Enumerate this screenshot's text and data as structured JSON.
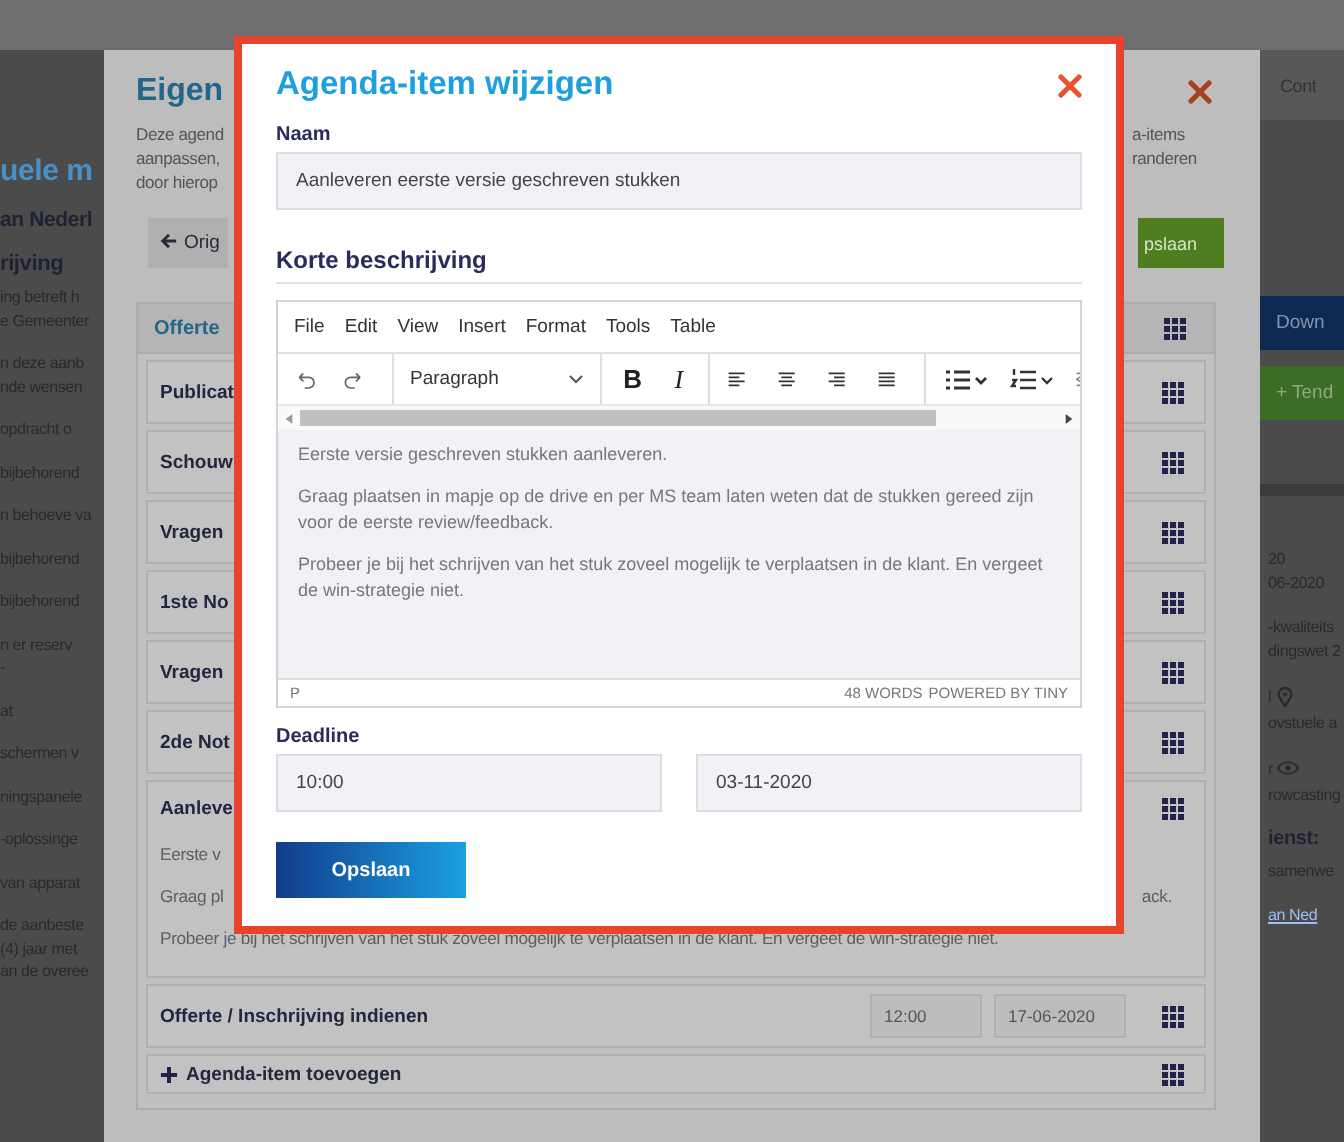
{
  "background_page": {
    "header_tab": "Cont",
    "left_blocks": [
      {
        "kind": "title",
        "lines": [
          "uele m"
        ]
      },
      {
        "kind": "subtitle",
        "lines": [
          "an Nederl"
        ]
      },
      {
        "kind": "heading",
        "lines": [
          "rijving"
        ]
      },
      {
        "kind": "text",
        "lines": [
          "ing betreft h",
          "e Gemeenter"
        ]
      },
      {
        "kind": "text",
        "lines": [
          "n deze aanb",
          "nde wensen"
        ]
      },
      {
        "kind": "text",
        "lines": [
          "opdracht o"
        ]
      },
      {
        "kind": "text",
        "lines": [
          "bijbehorend"
        ]
      },
      {
        "kind": "text",
        "lines": [
          "n behoeve va"
        ]
      },
      {
        "kind": "text",
        "lines": [
          "bijbehorend"
        ]
      },
      {
        "kind": "text",
        "lines": [
          "bijbehorend"
        ]
      },
      {
        "kind": "text",
        "lines": [
          "n er reserv",
          "-"
        ]
      },
      {
        "kind": "text",
        "lines": [
          "at"
        ]
      },
      {
        "kind": "text",
        "lines": [
          "schermen v"
        ]
      },
      {
        "kind": "text",
        "lines": [
          "ningspanele"
        ]
      },
      {
        "kind": "text",
        "lines": [
          "-oplossinge"
        ]
      },
      {
        "kind": "text",
        "lines": [
          "van apparat"
        ]
      },
      {
        "kind": "text",
        "lines": [
          "de aanbeste",
          "(4) jaar met",
          "an de overee"
        ]
      }
    ],
    "right_items": [
      {
        "kind": "primary_button",
        "text": "Down"
      },
      {
        "kind": "success_button",
        "text": "+ Tend"
      },
      {
        "kind": "divider"
      },
      {
        "kind": "text",
        "lines": [
          "20",
          "06-2020"
        ]
      },
      {
        "kind": "text",
        "lines": [
          "-kwaliteits",
          "dingswet 2"
        ]
      },
      {
        "kind": "text_with_pin",
        "text": "l"
      },
      {
        "kind": "text",
        "lines": [
          "ovstuele a"
        ]
      },
      {
        "kind": "text_with_eye",
        "text": "r"
      },
      {
        "kind": "text",
        "lines": [
          "rowcasting"
        ]
      },
      {
        "kind": "heading",
        "lines": [
          "ienst:"
        ]
      },
      {
        "kind": "text",
        "lines": [
          "samenwe"
        ]
      },
      {
        "kind": "link",
        "lines": [
          "an Ned"
        ]
      }
    ]
  },
  "back_dialog": {
    "title": "Eigen",
    "description_left": [
      "Deze agend",
      "aanpassen,",
      "door hierop"
    ],
    "description_right": [
      "a-items",
      "randeren"
    ],
    "back_button": "Orig",
    "save_button": "pslaan",
    "agenda": {
      "header": "Offerte",
      "items": [
        {
          "title": "Publicat",
          "expanded": false
        },
        {
          "title": "Schouw",
          "expanded": false
        },
        {
          "title": "Vragen",
          "expanded": false
        },
        {
          "title": "1ste No",
          "expanded": false
        },
        {
          "title": "Vragen",
          "expanded": false
        },
        {
          "title": "2de Not",
          "expanded": false
        },
        {
          "title": "Aanleve",
          "expanded": true,
          "lines": [
            {
              "text": "Eerste v"
            },
            {
              "text": "Graag pl",
              "tail": "ack."
            },
            {
              "text": "Probeer je bij het schrijven van het stuk zoveel mogelijk te verplaatsen in de klant. En vergeet de win-strategie niet."
            }
          ]
        },
        {
          "title": "Offerte / Inschrijving indienen",
          "expanded": false,
          "time": "12:00",
          "date": "17-06-2020"
        }
      ],
      "add_label": "Agenda-item toevoegen"
    }
  },
  "dialog": {
    "title": "Agenda-item wijzigen",
    "name_label": "Naam",
    "name_value": "Aanleveren eerste versie geschreven stukken",
    "description_label": "Korte beschrijving",
    "editor": {
      "menu": [
        "File",
        "Edit",
        "View",
        "Insert",
        "Format",
        "Tools",
        "Table"
      ],
      "toolbar": [
        {
          "tools": [
            {
              "kind": "undo"
            },
            {
              "kind": "redo"
            }
          ]
        },
        {
          "tools": [
            {
              "kind": "block_format",
              "label": "Paragraph"
            }
          ]
        },
        {
          "tools": [
            {
              "kind": "bold",
              "label": "B"
            },
            {
              "kind": "italic",
              "label": "I"
            }
          ]
        },
        {
          "tools": [
            {
              "kind": "align_left"
            },
            {
              "kind": "align_center"
            },
            {
              "kind": "align_right"
            },
            {
              "kind": "justify"
            }
          ]
        },
        {
          "tools": [
            {
              "kind": "bullet_list"
            },
            {
              "kind": "numbered_list"
            },
            {
              "kind": "outdent"
            }
          ]
        }
      ],
      "paragraphs": [
        "Eerste versie geschreven stukken aanleveren.",
        "Graag plaatsen in mapje op de drive en per MS team laten weten dat de stukken gereed zijn voor de eerste review/feedback.",
        "Probeer je bij het schrijven van het stuk zoveel mogelijk te verplaatsen in de klant. En vergeet de win-strategie niet."
      ],
      "path": "P",
      "word_count": "48 WORDS",
      "powered_by": "POWERED BY TINY"
    },
    "deadline_label": "Deadline",
    "time": "10:00",
    "date": "03-11-2020",
    "save_button": "Opslaan"
  }
}
